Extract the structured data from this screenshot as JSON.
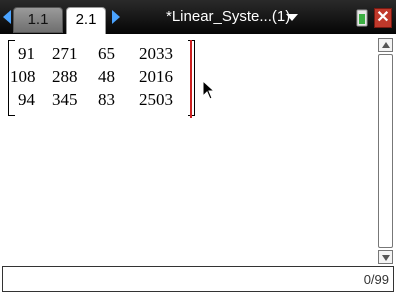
{
  "tabs": [
    {
      "label": "1.1",
      "active": false
    },
    {
      "label": "2.1",
      "active": true
    }
  ],
  "document": {
    "title": "*Linear_Syste...(1)"
  },
  "icons": {
    "nav_left": "left-arrow-icon",
    "nav_right": "right-arrow-icon",
    "title_menu": "chevron-down-icon",
    "battery": "battery-icon",
    "close": "close-icon",
    "pointer": "mouse-pointer-icon"
  },
  "close_label": "✕",
  "matrix": {
    "rows": [
      [
        "91",
        "271",
        "65",
        "2033"
      ],
      [
        "108",
        "288",
        "48",
        "2016"
      ],
      [
        "94",
        "345",
        "83",
        "2503"
      ]
    ]
  },
  "entry": {
    "counter": "0/99"
  },
  "colors": {
    "accent": "#4aa3ff",
    "cursor": "#cc2222",
    "close": "#c0392b"
  }
}
